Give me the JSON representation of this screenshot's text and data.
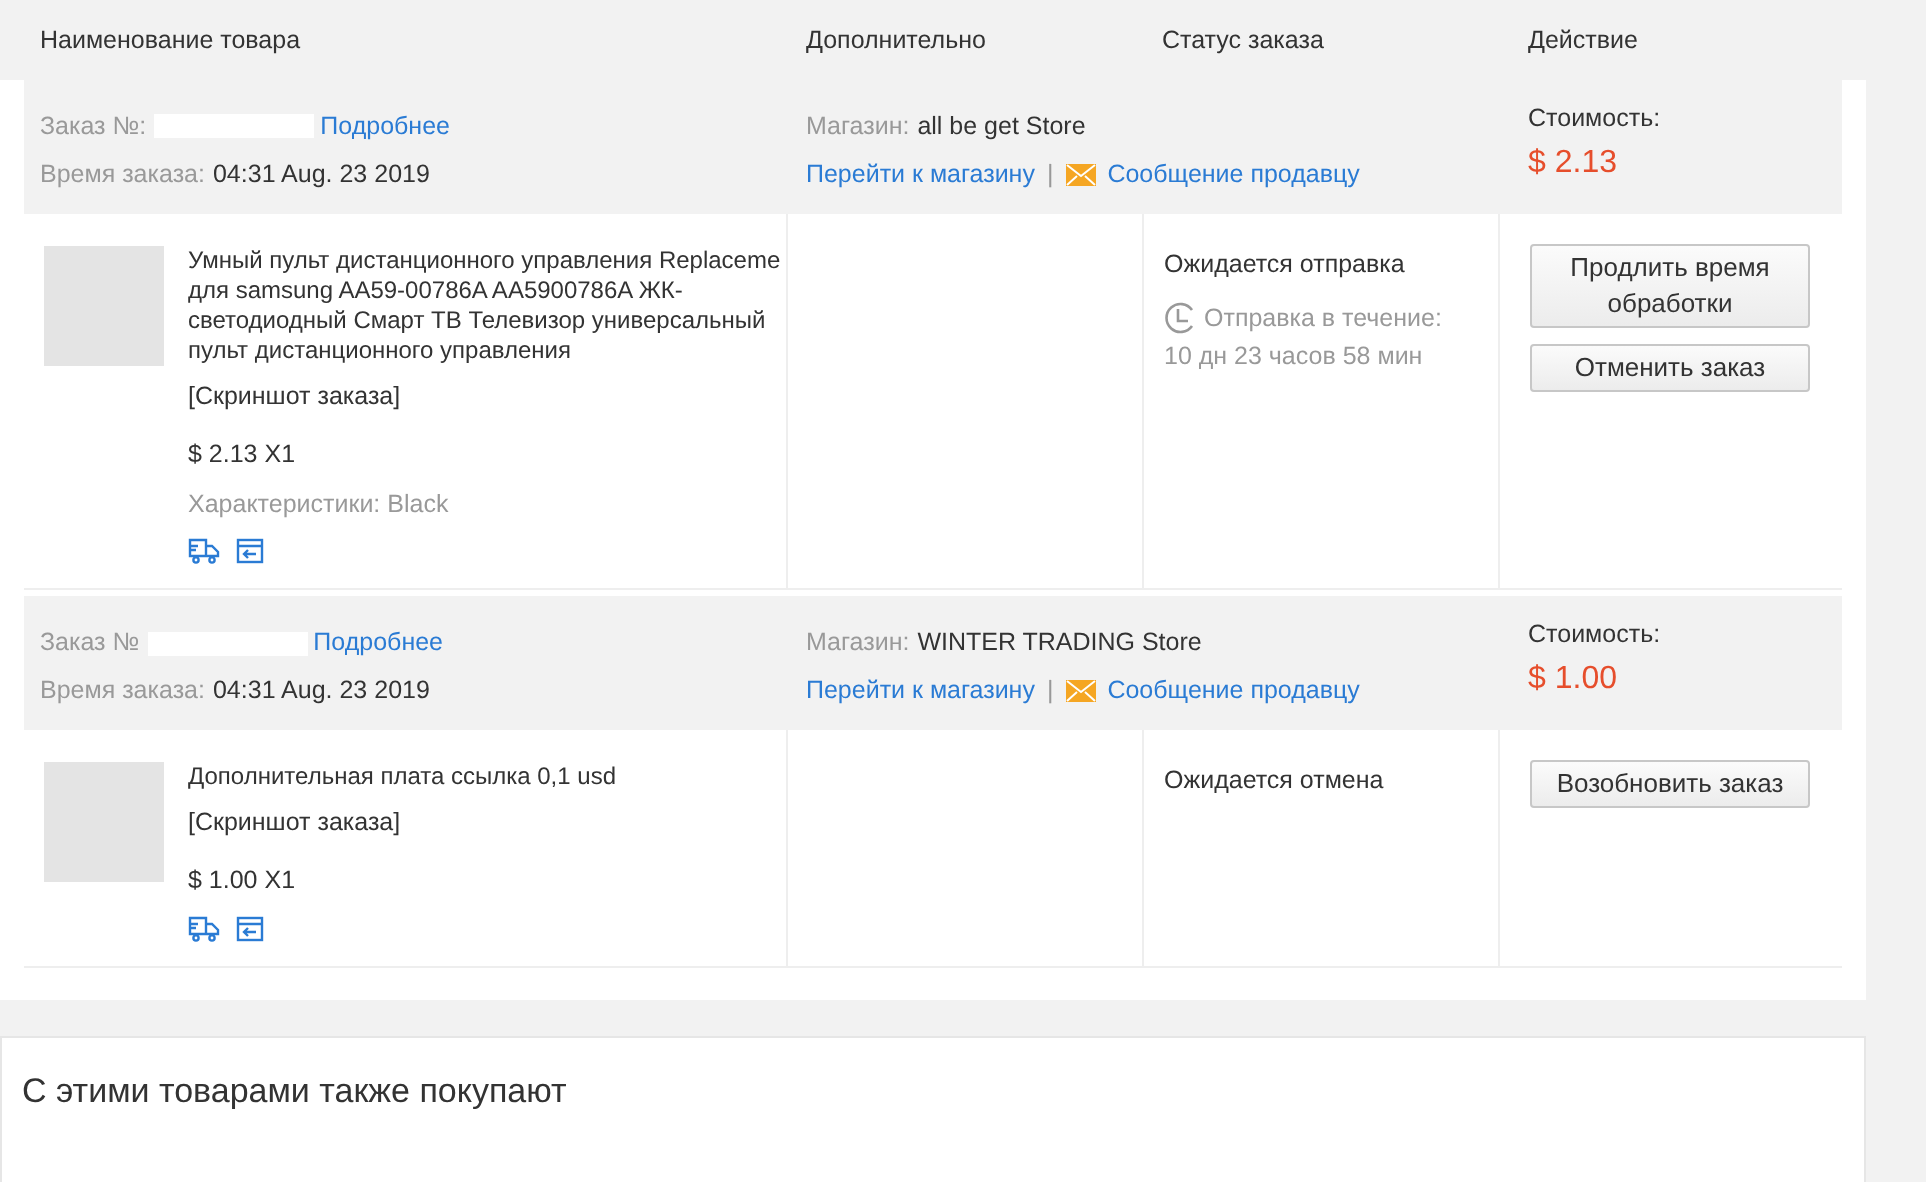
{
  "table": {
    "columns": [
      "Наименование товара",
      "Дополнительно",
      "Статус заказа",
      "Действие"
    ]
  },
  "orders": [
    {
      "order_label": "Заказ №:",
      "details_link": "Подробнее",
      "time_label": "Время заказа:",
      "time": "04:31 Aug. 23 2019",
      "store_label": "Магазин:",
      "store": "all be get Store",
      "store_link": "Перейти к магазину",
      "separator": "|",
      "message_link": "Сообщение продавцу",
      "cost_label": "Стоимость:",
      "cost": "$ 2.13",
      "item": {
        "title": "Умный пульт дистанционного управления Replaceme для samsung AA59-00786A AA5900786A ЖК-светодиодный Смарт ТВ Телевизор универсальный пульт дистанционного управления",
        "screenshot_link": "[Скриншот заказа]",
        "price": "$ 2.13 X1",
        "specs": "Характеристики: Black"
      },
      "status": "Ожидается отправка",
      "countdown": {
        "label": "Отправка в течение:",
        "time": "10 дн 23 часов 58 мин"
      },
      "actions": [
        "Продлить время обработки",
        "Отменить заказ"
      ]
    },
    {
      "order_label": "Заказ №",
      "details_link": "Подробнее",
      "time_label": "Время заказа:",
      "time": "04:31 Aug. 23 2019",
      "store_label": "Магазин:",
      "store": "WINTER TRADING Store",
      "store_link": "Перейти к магазину",
      "separator": "|",
      "message_link": "Сообщение продавцу",
      "cost_label": "Стоимость:",
      "cost": "$ 1.00",
      "item": {
        "title": "Дополнительная плата ссылка 0,1 usd",
        "screenshot_link": "[Скриншот заказа]",
        "price": "$ 1.00 X1"
      },
      "status": "Ожидается отмена",
      "actions": [
        "Возобновить заказ"
      ]
    }
  ],
  "recommendations": {
    "title": "С этими товарами также покупают"
  }
}
